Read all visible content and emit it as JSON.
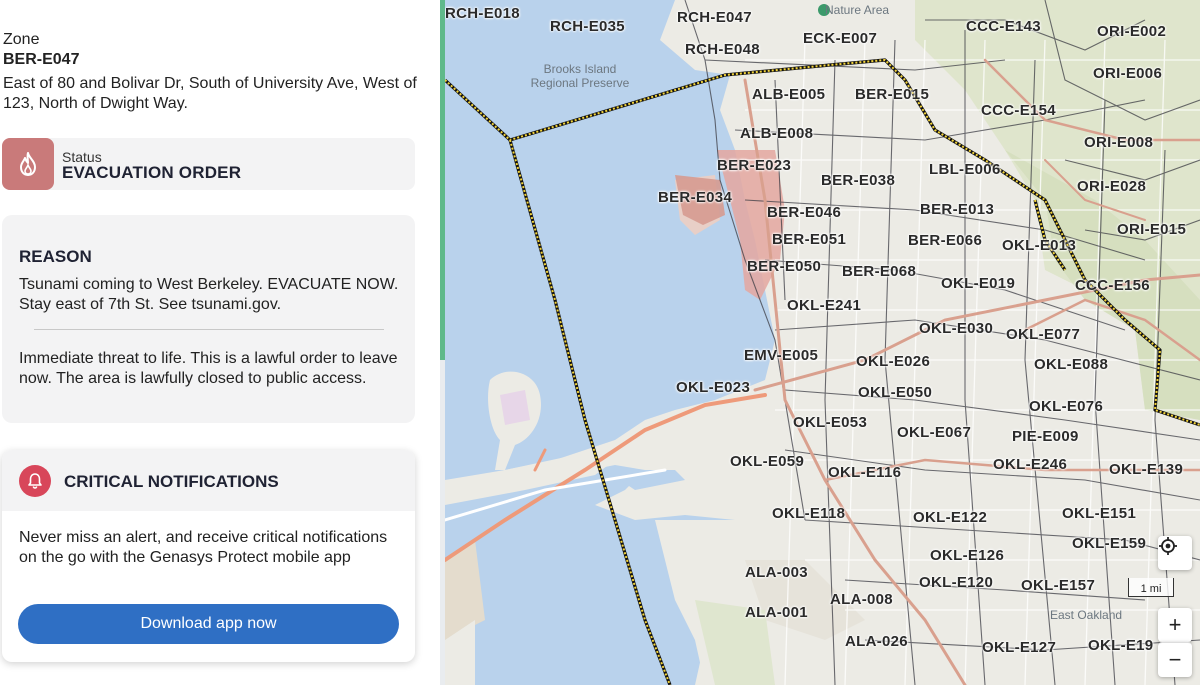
{
  "zone": {
    "label": "Zone",
    "id": "BER-E047",
    "description": "East of 80 and Bolivar Dr, South of University Ave, West of 123, North of Dwight Way."
  },
  "status": {
    "label": "Status",
    "value": "EVACUATION ORDER",
    "icon": "fire-icon",
    "color": "#c97a7a"
  },
  "reason": {
    "title": "REASON",
    "text": "Tsunami coming to West Berkeley. EVACUATE NOW. Stay east of 7th St. See tsunami.gov.",
    "detail": "Immediate threat to life. This is a lawful order to leave now. The area is lawfully closed to public access."
  },
  "notifications": {
    "title": "CRITICAL NOTIFICATIONS",
    "icon": "bell-icon",
    "text": "Never miss an alert, and receive critical notifications on the go with the Genasys Protect mobile app",
    "button_label": "Download app now"
  },
  "map": {
    "place_labels": {
      "brooks": "Brooks Island Regional Preserve",
      "nature": "Nature Area",
      "east_oakland": "East Oakland"
    },
    "scale_label": "1 mi",
    "zoom_in": "+",
    "zoom_out": "−",
    "zones": [
      "RCH-E018",
      "RCH-E035",
      "RCH-E047",
      "RCH-E048",
      "ECK-E007",
      "CCC-E143",
      "ORI-E002",
      "ORI-E006",
      "ALB-E005",
      "BER-E015",
      "CCC-E154",
      "ALB-E008",
      "ORI-E008",
      "BER-E023",
      "BER-E038",
      "LBL-E006",
      "ORI-E028",
      "BER-E034",
      "BER-E046",
      "BER-E013",
      "ORI-E015",
      "BER-E051",
      "BER-E066",
      "OKL-E013",
      "BER-E050",
      "BER-E068",
      "OKL-E019",
      "CCC-E156",
      "OKL-E241",
      "OKL-E030",
      "OKL-E077",
      "EMV-E005",
      "OKL-E026",
      "OKL-E088",
      "OKL-E023",
      "OKL-E050",
      "OKL-E076",
      "OKL-E053",
      "OKL-E067",
      "PIE-E009",
      "OKL-E059",
      "OKL-E116",
      "OKL-E246",
      "OKL-E139",
      "OKL-E118",
      "OKL-E122",
      "OKL-E151",
      "OKL-E126",
      "OKL-E159",
      "ALA-003",
      "OKL-E120",
      "OKL-E157",
      "ALA-008",
      "ALA-001",
      "ALA-026",
      "OKL-E127",
      "OKL-E19"
    ]
  }
}
